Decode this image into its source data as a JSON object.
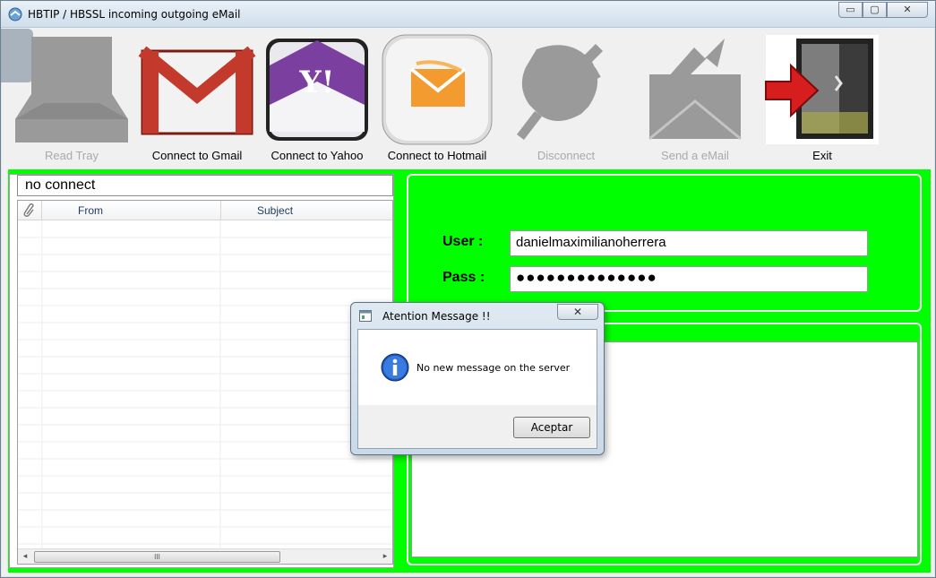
{
  "window": {
    "title": "HBTIP / HBSSL incoming outgoing eMail",
    "min_glyph": "▭",
    "max_glyph": "▢",
    "close_glyph": "✕"
  },
  "toolbar": {
    "items": [
      {
        "label": "Read Tray",
        "enabled": false,
        "icon": "tray-icon"
      },
      {
        "label": "Connect to Gmail",
        "enabled": true,
        "icon": "gmail-icon"
      },
      {
        "label": "Connect to Yahoo",
        "enabled": true,
        "icon": "yahoo-icon"
      },
      {
        "label": "Connect to Hotmail",
        "enabled": true,
        "icon": "hotmail-icon"
      },
      {
        "label": "Disconnect",
        "enabled": false,
        "icon": "plug-icon"
      },
      {
        "label": "Send a eMail",
        "enabled": false,
        "icon": "send-mail-icon"
      },
      {
        "label": "Exit",
        "enabled": true,
        "icon": "exit-door-icon"
      }
    ]
  },
  "status": {
    "text": "no connect"
  },
  "grid": {
    "columns": [
      "From",
      "Subject"
    ],
    "scroll_thumb": "III",
    "left_arrow": "◂",
    "right_arrow": "▸"
  },
  "login": {
    "user_label": "User :",
    "user_value": "danielmaximilianoherrera",
    "pass_label": "Pass :",
    "pass_value": "●●●●●●●●●●●●●●"
  },
  "dialog": {
    "title": "Atention Message !!",
    "message": "No new message on the server",
    "button": "Aceptar",
    "close_glyph": "✕"
  },
  "colors": {
    "panel_green": "#00ff00",
    "disabled_text": "#a9a9a9"
  }
}
